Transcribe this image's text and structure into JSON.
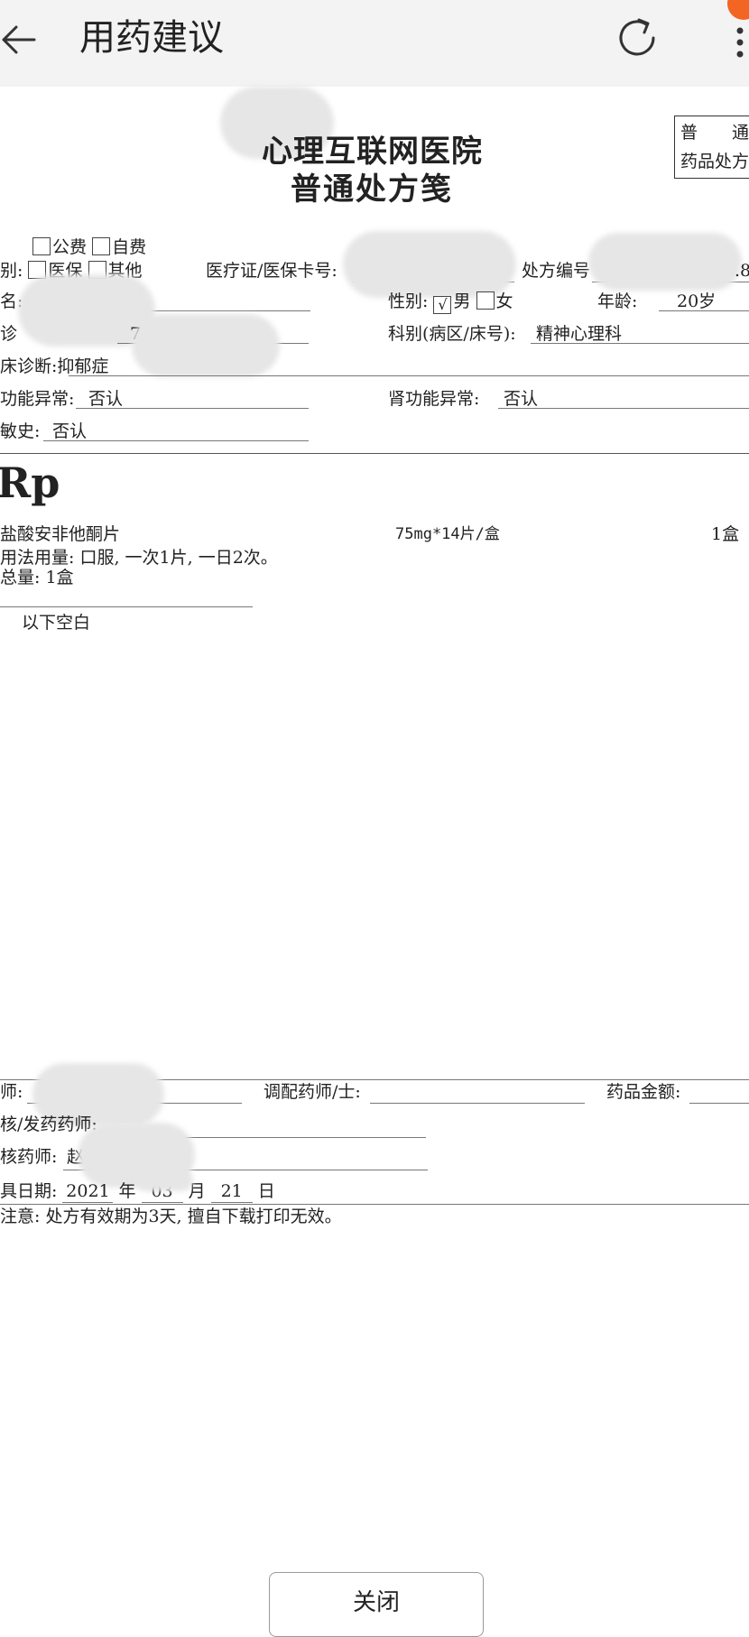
{
  "app_bar": {
    "title": "用药建议",
    "back_icon": "arrow-left-icon",
    "refresh_icon": "refresh-icon",
    "more_icon": "more-vert-icon",
    "notification_color": "#f26522"
  },
  "prescription": {
    "hospital_name": "心理互联网医院",
    "form_title": "普通处方笺",
    "corner_box": {
      "line1": "普　　通",
      "line2": "药品处方"
    },
    "payment": {
      "public": "公费",
      "self": "自费"
    },
    "category": {
      "label": "别:",
      "insurance": "医保",
      "other": "其他"
    },
    "card_label": "医疗证/医保卡号:",
    "rx_number_label": "处方编号",
    "rx_number_tail": ".8",
    "name_label": "名:",
    "gender_label": "性别:",
    "gender_male": "男",
    "gender_female": "女",
    "gender_checked": "√",
    "age_label": "年龄:",
    "age_value": "20岁",
    "clinic_label": "诊",
    "clinic_fragment": "7",
    "department_label": "科别(病区/床号):",
    "department_value": "精神心理科",
    "diagnosis_label": "床诊断:",
    "diagnosis_value": "抑郁症",
    "liver_label": "功能异常:",
    "liver_value": "否认",
    "kidney_label": "肾功能异常:",
    "kidney_value": "否认",
    "allergy_label": "敏史:",
    "allergy_value": "否认",
    "rp": "Rp",
    "drug_name": "盐酸安非他酮片",
    "drug_spec": "75mg*14片/盒",
    "drug_qty": "1盒",
    "usage": "用法用量: 口服, 一次1片, 一日2次。",
    "total": "总量: 1盒",
    "blank_note": "以下空白",
    "physician_label": "师:",
    "dispenser_label": "调配药师/士:",
    "amount_label": "药品金额:",
    "reviewer_label": "核/发药药师:",
    "checker_label": "核药师:",
    "checker_fragment": "赵",
    "date_label": "具日期:",
    "date_year": "2021",
    "year_unit": "年",
    "date_month": "03",
    "month_unit": "月",
    "date_day": "21",
    "day_unit": "日",
    "notice": "注意: 处方有效期为3天, 擅自下载打印无效。"
  },
  "close_button": "关闭"
}
